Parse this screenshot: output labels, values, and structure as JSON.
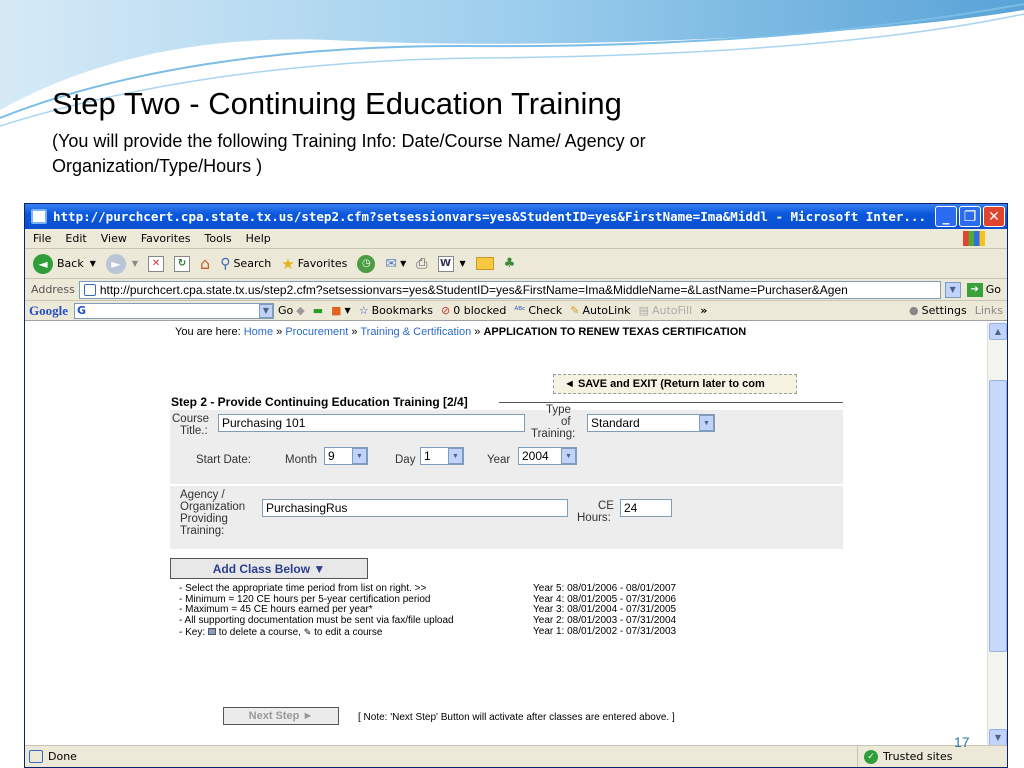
{
  "slide": {
    "title": "Step Two - Continuing Education Training",
    "subtitle": "(You will provide the following Training Info: Date/Course Name/ Agency or Organization/Type/Hours )",
    "page_number": "17"
  },
  "window": {
    "title": "http://purchcert.cpa.state.tx.us/step2.cfm?setsessionvars=yes&StudentID=yes&FirstName=Ima&Middl - Microsoft Inter...",
    "controls": {
      "minimize": "_",
      "restore": "❐",
      "close": "✕"
    }
  },
  "menu": [
    "File",
    "Edit",
    "View",
    "Favorites",
    "Tools",
    "Help"
  ],
  "toolbar": {
    "back": "Back",
    "search": "Search",
    "favorites": "Favorites"
  },
  "address": {
    "label": "Address",
    "url": "http://purchcert.cpa.state.tx.us/step2.cfm?setsessionvars=yes&StudentID=yes&FirstName=Ima&MiddleName=&LastName=Purchaser&Agen",
    "go": "Go"
  },
  "googlebar": {
    "logo": "Google",
    "search_value": "G",
    "go": "Go",
    "bookmarks": "Bookmarks",
    "blocked": "0 blocked",
    "check": "Check",
    "autolink": "AutoLink",
    "autofill": "AutoFill",
    "more": "»",
    "settings": "Settings",
    "links": "Links"
  },
  "breadcrumb": {
    "prefix": "You are here:",
    "home": "Home",
    "sep": "»",
    "procurement": "Procurement",
    "training": "Training & Certification",
    "current": "APPLICATION TO RENEW TEXAS CERTIFICATION"
  },
  "form": {
    "save_exit": "◄ SAVE and EXIT (Return later to com",
    "step_title": "Step 2 - Provide Continuing Education Training [2/4]",
    "course_title_label_1": "Course",
    "course_title_label_2": "Title.:",
    "course_title_value": "Purchasing 101",
    "type_label_1": "Type",
    "type_label_2": "of",
    "type_label_3": "Training:",
    "type_value": "Standard",
    "start_date_label": "Start Date:",
    "month_label": "Month",
    "month_value": "9",
    "day_label": "Day",
    "day_value": "1",
    "year_label": "Year",
    "year_value": "2004",
    "agency_label_1": "Agency /",
    "agency_label_2": "Organization",
    "agency_label_3": "Providing",
    "agency_label_4": "Training:",
    "agency_value": "PurchasingRus",
    "ce_label_1": "CE",
    "ce_label_2": "Hours:",
    "ce_value": "24",
    "add_class": "Add Class Below ▼",
    "notes": [
      "- Select the appropriate time period from list on right. >>",
      "- Minimum = 120 CE hours per 5-year certification period",
      "- Maximum = 45 CE hours earned per year*",
      "- All supporting documentation must be sent via fax/file upload",
      "- Key:  to delete a course,  to edit a course"
    ],
    "key_prefix": "- Key:",
    "key_delete": "to delete a course,",
    "key_edit": "to edit a course",
    "years": [
      "Year 5: 08/01/2006 - 08/01/2007",
      "Year 4: 08/01/2005 - 07/31/2006",
      "Year 3: 08/01/2004 - 07/31/2005",
      "Year 2: 08/01/2003 - 07/31/2004",
      "Year 1: 08/01/2002 - 07/31/2003"
    ],
    "next_step": "Next Step ►",
    "next_note": "[ Note: 'Next Step' Button will activate after classes are entered above. ]"
  },
  "status": {
    "done": "Done",
    "zone": "Trusted sites"
  },
  "colors": {
    "titlebar": "#0a58dc",
    "link": "#2c6ac7",
    "panel": "#ededed"
  }
}
